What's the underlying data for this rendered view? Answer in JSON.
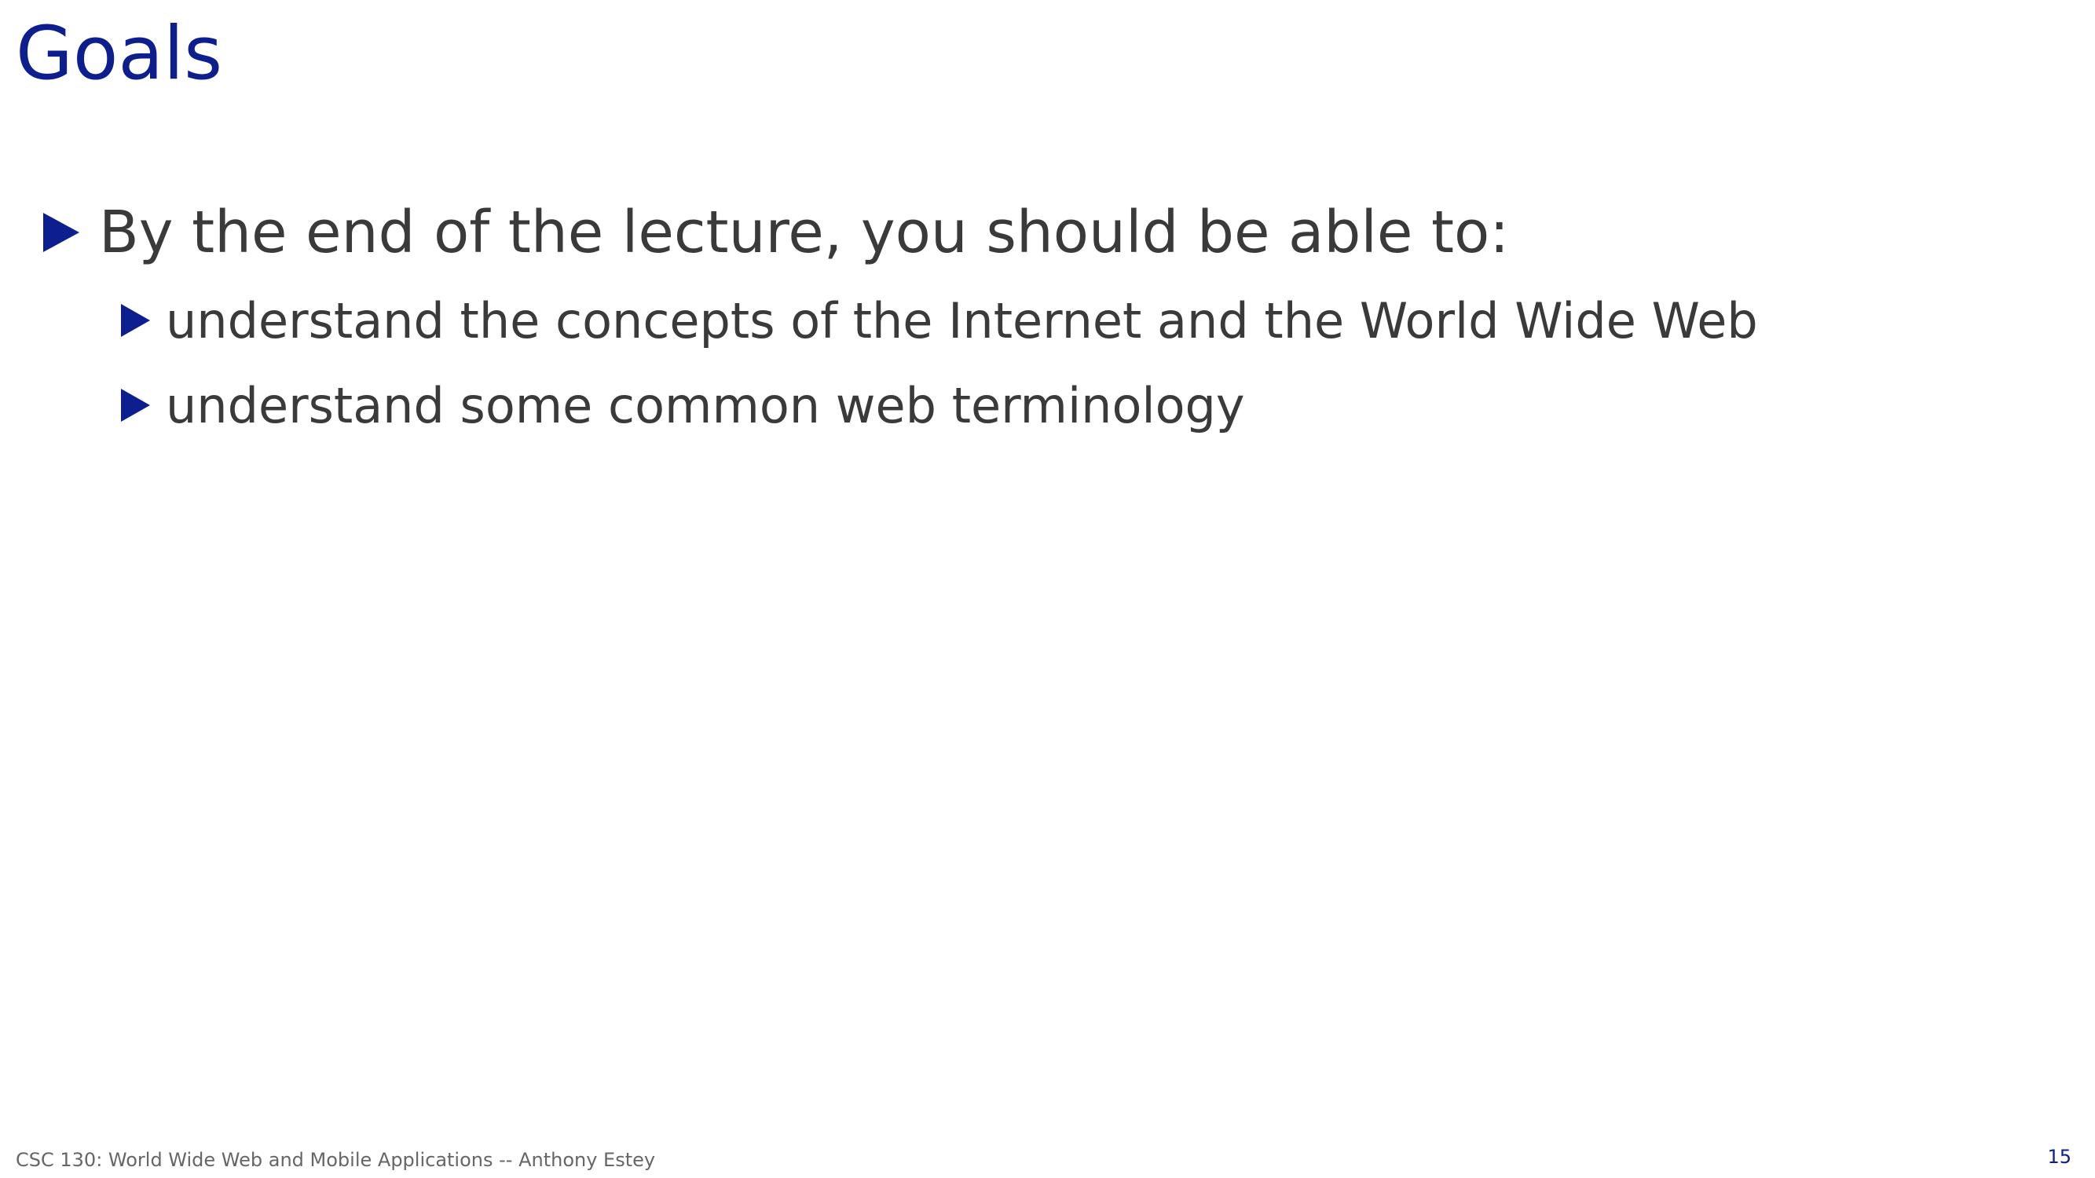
{
  "slide": {
    "title": "Goals",
    "bullets": [
      {
        "text": "By the end of the lecture, you should be able to:",
        "sub_bullets": [
          "understand the concepts of the Internet and the World Wide Web",
          "understand some common web terminology"
        ]
      }
    ]
  },
  "footer": {
    "text": "CSC 130: World Wide Web and Mobile Applications -- Anthony Estey",
    "page_number": "15"
  },
  "colors": {
    "title": "#0D1E8E",
    "bullet_marker": "#0D1E8E",
    "body_text": "#3A3A3A",
    "footer_text": "#666666",
    "background": "#FFFFFF"
  },
  "icons": {
    "bullet_marker": "triangle-right-icon"
  }
}
